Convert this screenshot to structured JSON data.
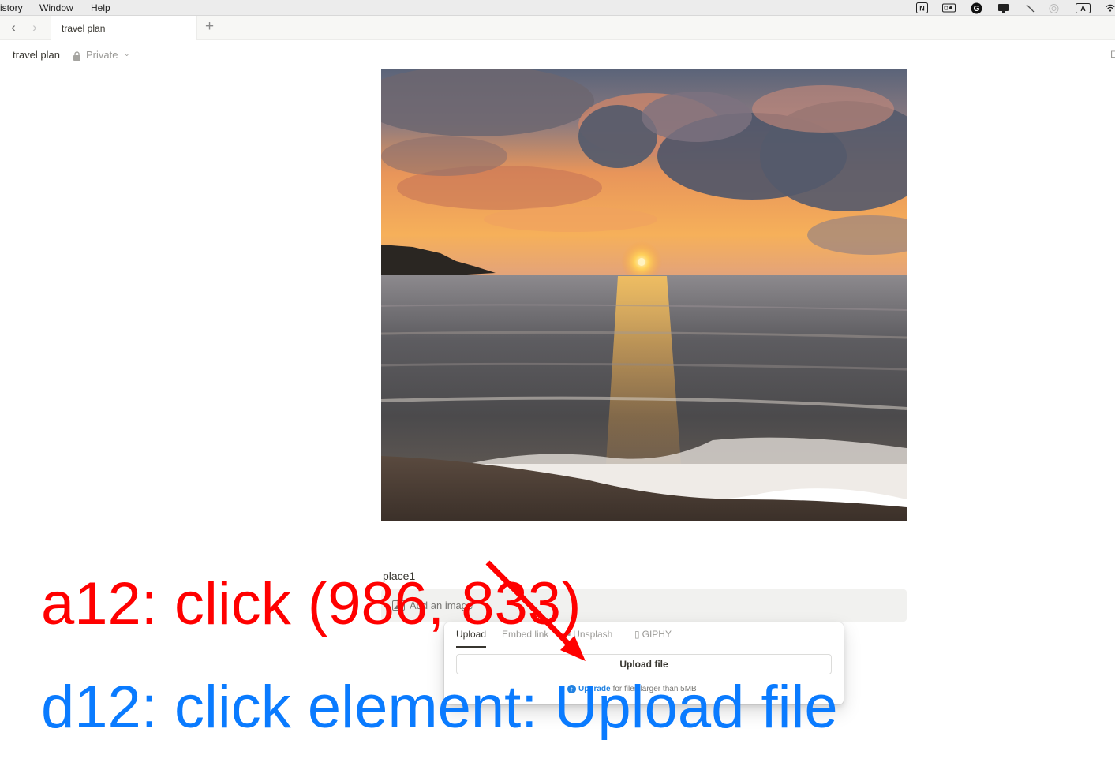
{
  "menubar": {
    "items": [
      "istory",
      "Window",
      "Help"
    ],
    "status_icons": [
      "notion-icon",
      "screen-record-icon",
      "grammarly-icon",
      "display-icon",
      "mute-icon",
      "airdrop-icon",
      "input-source-icon",
      "wifi-icon"
    ],
    "input_source_label": "A",
    "notion_label": "N"
  },
  "tabbar": {
    "back_glyph": "‹",
    "forward_glyph": "›",
    "tab_label": "travel plan",
    "new_tab_glyph": "+"
  },
  "header": {
    "title": "travel plan",
    "privacy": "Private",
    "chevron": "⌄",
    "edge_letter": "E"
  },
  "content": {
    "place_label": "place1",
    "add_image_label": "Add an image"
  },
  "upload_popover": {
    "tabs": [
      "Upload",
      "Embed link",
      "Unsplash",
      "GIPHY"
    ],
    "active_tab": "Upload",
    "upload_button": "Upload file",
    "upgrade_link": "Upgrade",
    "upgrade_note": "for files larger than 5MB"
  },
  "annotation": {
    "action": "a12: click (986, 833)",
    "description": "d12: click element: Upload file",
    "action_color": "#ff0000",
    "description_color": "#0a7bff"
  }
}
